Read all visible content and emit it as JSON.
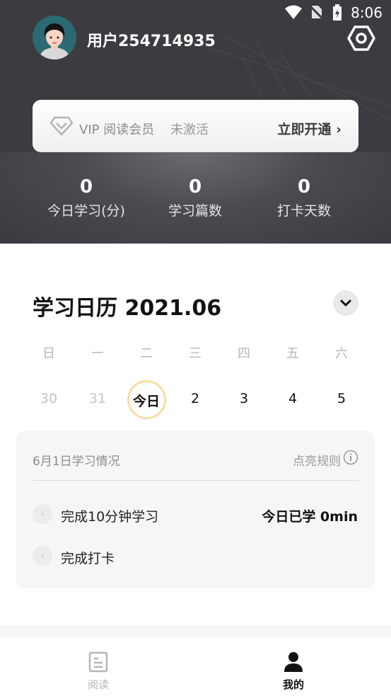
{
  "status_bar": {
    "time": "8:06"
  },
  "profile": {
    "username": "用户254714935"
  },
  "vip": {
    "title": "VIP 阅读会员",
    "status": "未激活",
    "action": "立即开通"
  },
  "stats": [
    {
      "value": "0",
      "label": "今日学习(分)"
    },
    {
      "value": "0",
      "label": "学习篇数"
    },
    {
      "value": "0",
      "label": "打卡天数"
    }
  ],
  "calendar": {
    "title": "学习日历 2021.06",
    "weekdays": [
      "日",
      "一",
      "二",
      "三",
      "四",
      "五",
      "六"
    ],
    "days": [
      {
        "label": "30",
        "state": "outside"
      },
      {
        "label": "31",
        "state": "outside"
      },
      {
        "label": "今日",
        "state": "today"
      },
      {
        "label": "2",
        "state": "normal"
      },
      {
        "label": "3",
        "state": "normal"
      },
      {
        "label": "4",
        "state": "normal"
      },
      {
        "label": "5",
        "state": "normal"
      }
    ]
  },
  "summary": {
    "title": "6月1日学习情况",
    "rules_label": "点亮规则",
    "tasks": [
      {
        "label": "完成10分钟学习",
        "done": false
      },
      {
        "label": "完成打卡",
        "done": false
      }
    ],
    "today_studied": "今日已学 0min"
  },
  "tabbar": {
    "items": [
      {
        "label": "阅读",
        "icon": "document-icon",
        "active": false
      },
      {
        "label": "我的",
        "icon": "person-icon",
        "active": true
      }
    ]
  },
  "colors": {
    "header_bg": "#3c3b40",
    "today_ring": "#f5dfa3",
    "active_tab": "#111111",
    "inactive_tab": "#b5b5b5"
  }
}
